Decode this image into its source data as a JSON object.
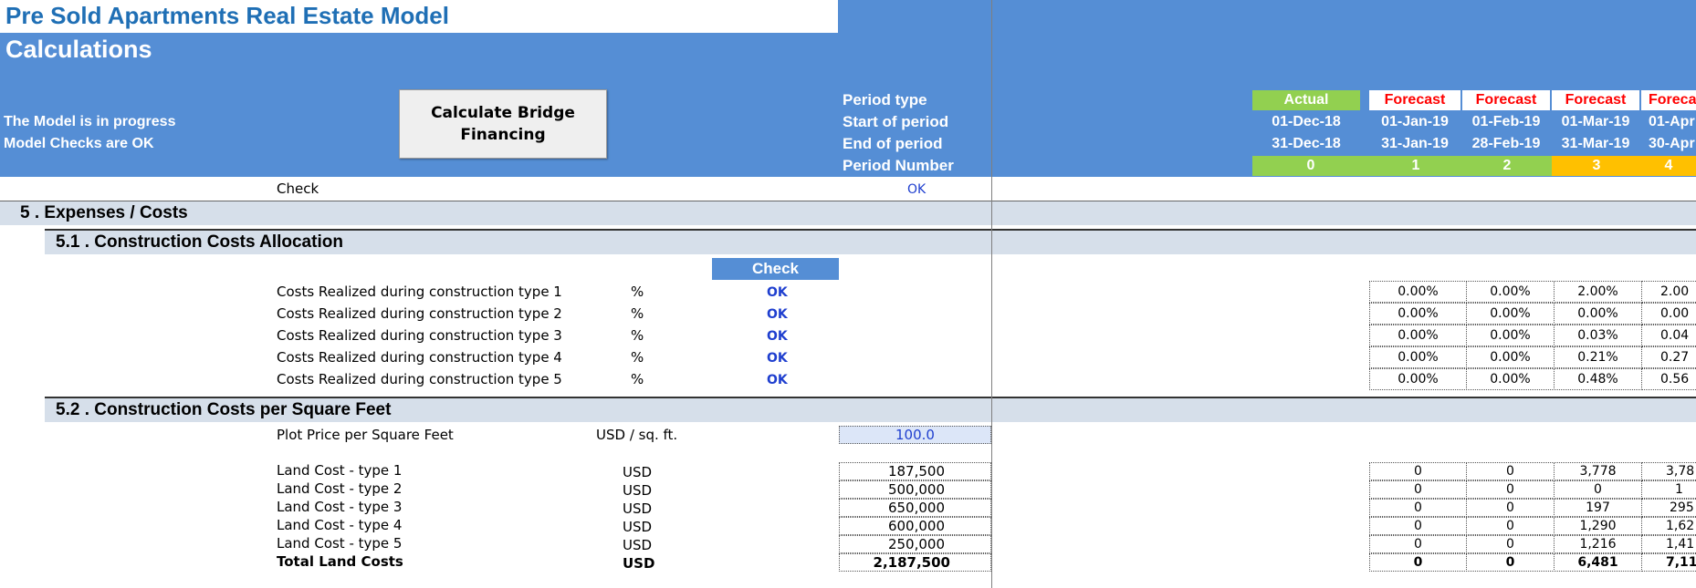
{
  "header": {
    "title": "Pre Sold Apartments Real Estate Model",
    "subtitle": "Calculations",
    "status_progress": "The Model is in progress",
    "status_checks": "Model Checks are OK",
    "button_label": "Calculate Bridge\nFinancing",
    "check_label": "Check",
    "check_value": "OK"
  },
  "periods": {
    "labels": [
      "Period type",
      "Start of period",
      "End of period",
      "Period Number"
    ],
    "columns": [
      {
        "type": "Actual",
        "start": "01-Dec-18",
        "end": "31-Dec-18",
        "number": "0"
      },
      {
        "type": "Forecast",
        "start": "01-Jan-19",
        "end": "31-Jan-19",
        "number": "1"
      },
      {
        "type": "Forecast",
        "start": "01-Feb-19",
        "end": "28-Feb-19",
        "number": "2"
      },
      {
        "type": "Forecast",
        "start": "01-Mar-19",
        "end": "31-Mar-19",
        "number": "3"
      },
      {
        "type": "Forecast",
        "start": "01-Apr",
        "end": "30-Apr",
        "number": "4"
      }
    ]
  },
  "section5": {
    "title": "5 . Expenses / Costs"
  },
  "section51": {
    "title": "5.1 . Construction Costs Allocation",
    "check_header": "Check",
    "rows": [
      {
        "label": "Costs Realized during construction type 1",
        "unit": "%",
        "check": "OK",
        "values": [
          "0.00%",
          "0.00%",
          "2.00%",
          "2.00"
        ]
      },
      {
        "label": "Costs Realized during construction type 2",
        "unit": "%",
        "check": "OK",
        "values": [
          "0.00%",
          "0.00%",
          "0.00%",
          "0.00"
        ]
      },
      {
        "label": "Costs Realized during construction type 3",
        "unit": "%",
        "check": "OK",
        "values": [
          "0.00%",
          "0.00%",
          "0.03%",
          "0.04"
        ]
      },
      {
        "label": "Costs Realized during construction type 4",
        "unit": "%",
        "check": "OK",
        "values": [
          "0.00%",
          "0.00%",
          "0.21%",
          "0.27"
        ]
      },
      {
        "label": "Costs Realized during construction type 5",
        "unit": "%",
        "check": "OK",
        "values": [
          "0.00%",
          "0.00%",
          "0.48%",
          "0.56"
        ]
      }
    ]
  },
  "section52": {
    "title": "5.2 . Construction Costs per Square Feet",
    "plot_label": "Plot Price per Square Feet",
    "plot_unit": "USD / sq. ft.",
    "plot_value": "100.0",
    "rows": [
      {
        "label": "Land Cost - type 1",
        "unit": "USD",
        "total": "187,500",
        "values": [
          "0",
          "0",
          "3,778",
          "3,78"
        ]
      },
      {
        "label": "Land Cost - type 2",
        "unit": "USD",
        "total": "500,000",
        "values": [
          "0",
          "0",
          "0",
          "1"
        ]
      },
      {
        "label": "Land Cost - type 3",
        "unit": "USD",
        "total": "650,000",
        "values": [
          "0",
          "0",
          "197",
          "295"
        ]
      },
      {
        "label": "Land Cost - type 4",
        "unit": "USD",
        "total": "600,000",
        "values": [
          "0",
          "0",
          "1,290",
          "1,62"
        ]
      },
      {
        "label": "Land Cost - type 5",
        "unit": "USD",
        "total": "250,000",
        "values": [
          "0",
          "0",
          "1,216",
          "1,41"
        ]
      }
    ],
    "total_row": {
      "label": "Total Land Costs",
      "unit": "USD",
      "total": "2,187,500",
      "values": [
        "0",
        "0",
        "6,481",
        "7,11"
      ]
    }
  },
  "colors": {
    "header_blue": "#558ED5",
    "title_blue": "#1F6FB5",
    "actual_green": "#92D050",
    "forecast_red": "#FF0000",
    "period_orange": "#FFC000",
    "section_band": "#D6DFEA",
    "ok_blue": "#1F3FCF"
  }
}
